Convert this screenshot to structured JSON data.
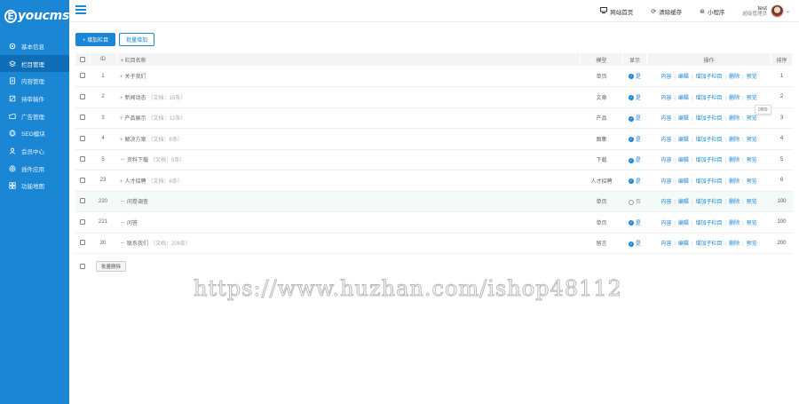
{
  "brand": {
    "logo_letter": "E",
    "logo_text": "youcms"
  },
  "sidebar": {
    "items": [
      {
        "label": "基本信息",
        "icon": "gear-icon",
        "active": false
      },
      {
        "label": "栏目管理",
        "icon": "layers-icon",
        "active": true
      },
      {
        "label": "内容管理",
        "icon": "document-icon",
        "active": false
      },
      {
        "label": "待审稿件",
        "icon": "edit-icon",
        "active": false
      },
      {
        "label": "广告管理",
        "icon": "folder-icon",
        "active": false
      },
      {
        "label": "SEO模块",
        "icon": "globe-icon",
        "active": false
      },
      {
        "label": "会员中心",
        "icon": "user-icon",
        "active": false
      },
      {
        "label": "插件应用",
        "icon": "plugin-icon",
        "active": false
      },
      {
        "label": "功能地图",
        "icon": "grid-icon",
        "active": false
      }
    ]
  },
  "topbar": {
    "home_link": "网站首页",
    "cache_link": "清除缓存",
    "mini_link": "小程序",
    "user_name": "test",
    "user_role": "超级管理员"
  },
  "toolbar": {
    "add_label": "+ 增加栏目",
    "batch_add_label": "批量增加"
  },
  "table": {
    "headers": {
      "id": "ID",
      "name": "+ 栏目名称",
      "model": "模型",
      "show": "显示",
      "ops": "操作",
      "sort": "排序"
    },
    "rows": [
      {
        "id": "1",
        "prefix": "+",
        "name": "关于我们",
        "meta": "",
        "model": "单页",
        "show": "是",
        "visible": true,
        "sort": "1"
      },
      {
        "id": "2",
        "prefix": "+",
        "name": "新闻动态",
        "meta": "（文档：15条）",
        "model": "文章",
        "show": "是",
        "visible": true,
        "sort": "2"
      },
      {
        "id": "3",
        "prefix": "+",
        "name": "产品展示",
        "meta": "（文档：12条）",
        "model": "产品",
        "show": "是",
        "visible": true,
        "sort": "3"
      },
      {
        "id": "4",
        "prefix": "+",
        "name": "解决方案",
        "meta": "（文档：6条）",
        "model": "图集",
        "show": "是",
        "visible": true,
        "sort": "4"
      },
      {
        "id": "5",
        "prefix": "－",
        "name": "资料下载",
        "meta": "（文档：5条）",
        "model": "下载",
        "show": "是",
        "visible": true,
        "sort": "5"
      },
      {
        "id": "23",
        "prefix": "+",
        "name": "人才招聘",
        "meta": "（文档：6条）",
        "model": "人才招聘",
        "show": "是",
        "visible": true,
        "sort": "6"
      },
      {
        "id": "220",
        "prefix": "－",
        "name": "问卷调查",
        "meta": "",
        "model": "单页",
        "show": "否",
        "visible": false,
        "sort": "100",
        "highlight": true
      },
      {
        "id": "221",
        "prefix": "－",
        "name": "问答",
        "meta": "",
        "model": "单页",
        "show": "是",
        "visible": true,
        "sort": "100"
      },
      {
        "id": "30",
        "prefix": "－",
        "name": "联系我们",
        "meta": "（文档：206条）",
        "model": "留言",
        "show": "是",
        "visible": true,
        "sort": "200"
      }
    ],
    "ops": {
      "content": "内容",
      "edit": "编辑",
      "add_sub": "增加子栏目",
      "delete": "删除",
      "preview": "预览"
    },
    "tooltip": "0到9"
  },
  "footer": {
    "batch_delete_label": "批量删除"
  },
  "watermark": "https://www.huzhan.com/ishop48112",
  "colors": {
    "primary": "#1b86d4",
    "sidebar_active": "#0f6db5"
  }
}
